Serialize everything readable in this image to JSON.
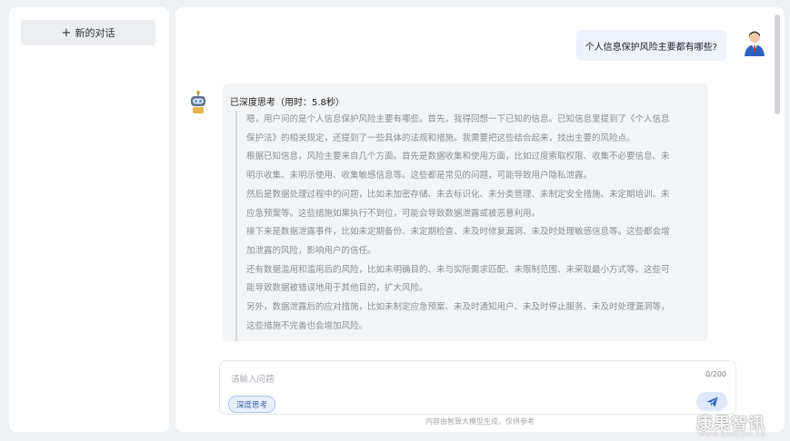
{
  "sidebar": {
    "new_chat_label": "新的对话"
  },
  "conversation": {
    "user_message": "个人信息保护风险主要都有哪些?",
    "thinking_title": "已深度思考（用时：5.8秒）",
    "thinking_lines": [
      "嗯，用户问的是个人信息保护风险主要有哪些。首先，我得回想一下已知的信息。已知信息里提到了《个人信息",
      "保护法》的相关规定，还提到了一些具体的法规和措施。我需要把这些结合起来，找出主要的风险点。",
      "根据已知信息，风险主要来自几个方面。首先是数据收集和使用方面，比如过度索取权限、收集不必要信息、未",
      "明示收集、未明示使用、收集敏感信息等。这些都是常见的问题，可能导致用户隐私泄露。",
      "然后是数据处理过程中的问题，比如未加密存储、未去标识化、未分类管理、未制定安全措施、未定期培训、未",
      "应急预案等。这些措施如果执行不到位，可能会导致数据泄露或被恶意利用。",
      "接下来是数据泄露事件，比如未定期备份、未定期检查、未及时修复漏洞、未及时处理敏感信息等。这些都会增",
      "加泄露的风险，影响用户的信任。",
      "还有数据滥用和滥用后的风险，比如未明确目的、未与实际需求匹配、未限制范围、未采取最小方式等。这些可",
      "能导致数据被错误地用于其他目的，扩大风险。",
      "另外，数据泄露后的应对措施，比如未制定应急预案、未及时通知用户、未及时停止服务、未及时处理漏洞等，",
      "这些措施不完善也会增加风险。"
    ]
  },
  "input": {
    "placeholder": "请输入问题",
    "counter": "0/200",
    "deep_think_label": "深度思考"
  },
  "footer": {
    "note": "内容由智算大模型生成，仅供参考"
  },
  "watermark": {
    "brand": "康果智讯",
    "url": "WWW.KOGUOAI.CN"
  },
  "colors": {
    "accent": "#3a6fd8",
    "toggle_bg": "#e8f0fd",
    "card_bg": "#f3f4f6"
  },
  "icons": {
    "new_chat": "plus-icon",
    "send": "send-icon",
    "user_avatar": "businessman-avatar",
    "bot_avatar": "robot-avatar"
  }
}
